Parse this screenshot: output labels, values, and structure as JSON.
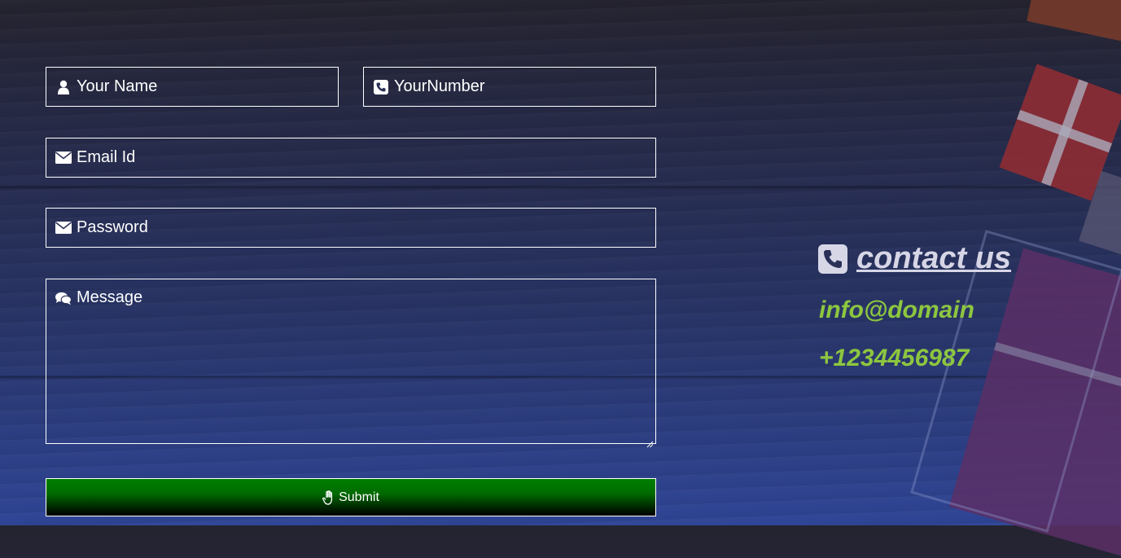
{
  "form": {
    "name_placeholder": "Your Name",
    "number_placeholder": "YourNumber",
    "email_placeholder": "Email Id",
    "password_placeholder": "Password",
    "message_placeholder": "Message",
    "submit_label": "Submit",
    "icons": {
      "name": "user-icon",
      "number": "phone-square-icon",
      "email": "envelope-icon",
      "password": "envelope-icon",
      "message": "comments-icon",
      "submit": "hand-icon"
    }
  },
  "contact": {
    "title": "contact us",
    "email": "info@domain",
    "phone": "+1234456987",
    "icon": "phone-square-icon"
  },
  "colors": {
    "accent_green": "#8dc63f",
    "submit_green": "#008000",
    "heading_text": "#d6d6e6"
  }
}
